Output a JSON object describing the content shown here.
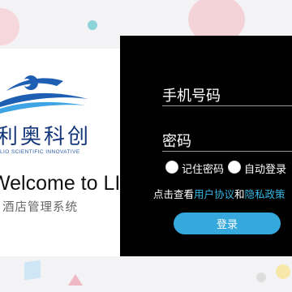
{
  "brand": {
    "name_cn": "利奥科创",
    "name_en": "LIO SCIENTIFIC INNOVATIVE",
    "welcome": "Welcome to LIO",
    "subtitle": "酒店管理系统"
  },
  "login": {
    "phone_placeholder": "手机号码",
    "password_placeholder": "密码",
    "remember_label": "记住密码",
    "auto_login_label": "自动登录",
    "agreement_prefix": "点击查看",
    "user_agreement": "用户协议",
    "and": "和",
    "privacy_policy": "隐私政策",
    "submit_label": "登录"
  },
  "colors": {
    "accent": "#35a9dc",
    "brand_blue": "#14367a",
    "panel_bg": "#000000"
  },
  "icons": [
    "swimmer-logo-icon"
  ]
}
